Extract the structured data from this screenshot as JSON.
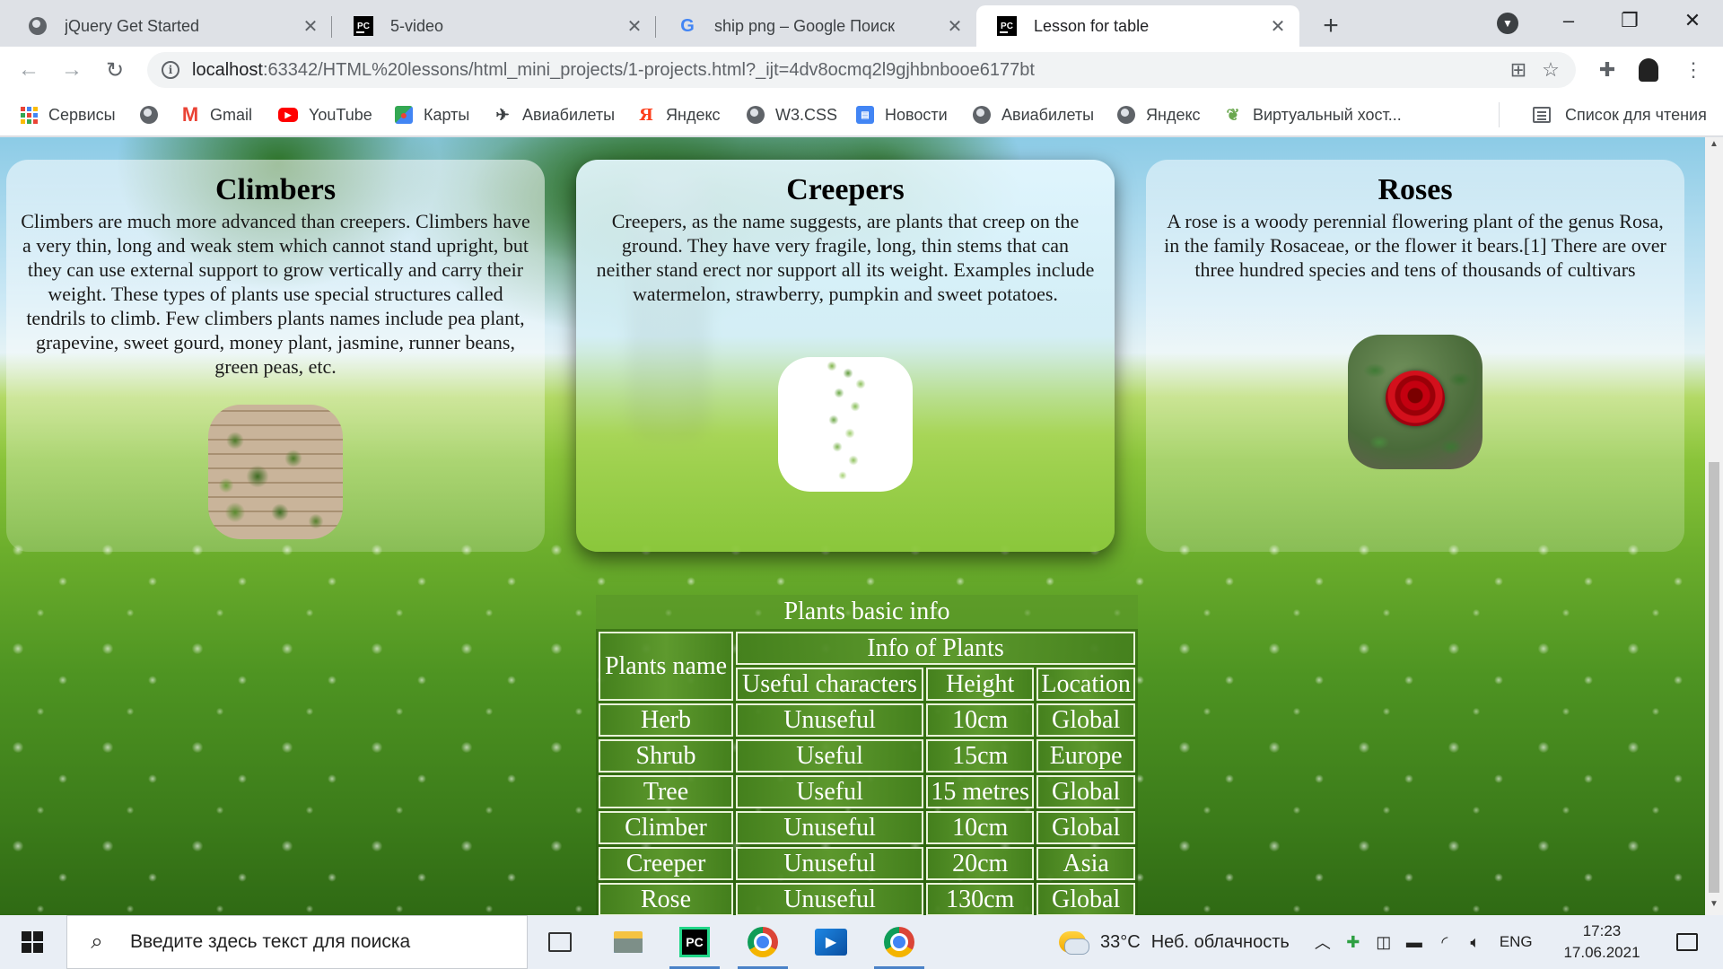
{
  "browser": {
    "tabs": [
      {
        "title": "jQuery Get Started",
        "icon": "globe-icon",
        "active": false
      },
      {
        "title": "5-video",
        "icon": "pycharm-icon",
        "active": false
      },
      {
        "title": "ship png – Google Поиск",
        "icon": "google-icon",
        "active": false
      },
      {
        "title": "Lesson for table",
        "icon": "pycharm-icon",
        "active": true
      }
    ],
    "url_host": "localhost",
    "url_rest": ":63342/HTML%20lessons/html_mini_projects/1-projects.html?_ijt=4dv8ocmq2l9gjhbnbooe6177bt",
    "bookmarks": [
      {
        "label": "Сервисы",
        "icon": "apps-grid-icon"
      },
      {
        "label": "",
        "icon": "globe-icon"
      },
      {
        "label": "Gmail",
        "icon": "gmail-icon"
      },
      {
        "label": "YouTube",
        "icon": "youtube-icon"
      },
      {
        "label": "Карты",
        "icon": "maps-icon"
      },
      {
        "label": "Авиабилеты",
        "icon": "plane-icon"
      },
      {
        "label": "Яндекс",
        "icon": "yandex-icon"
      },
      {
        "label": "W3.CSS",
        "icon": "globe-icon"
      },
      {
        "label": "Новости",
        "icon": "news-icon"
      },
      {
        "label": "Авиабилеты",
        "icon": "globe-icon"
      },
      {
        "label": "Яндекс",
        "icon": "globe-icon"
      },
      {
        "label": "Виртуальный хост...",
        "icon": "leaf-icon"
      }
    ],
    "reading_list": "Список для чтения"
  },
  "page": {
    "cards": [
      {
        "title": "Climbers",
        "text": "Climbers are much more advanced than creepers. Climbers have a very thin, long and weak stem which cannot stand upright, but they can use external support to grow vertically and carry their weight. These types of plants use special structures called tendrils to climb. Few climbers plants names include pea plant, grapevine, sweet gourd, money plant, jasmine, runner beans, green peas, etc."
      },
      {
        "title": "Creepers",
        "text": "Creepers, as the name suggests, are plants that creep on the ground. They have very fragile, long, thin stems that can neither stand erect nor support all its weight. Examples include watermelon, strawberry, pumpkin and sweet potatoes."
      },
      {
        "title": "Roses",
        "text": "A rose is a woody perennial flowering plant of the genus Rosa, in the family Rosaceae, or the flower it bears.[1] There are over three hundred species and tens of thousands of cultivars"
      }
    ],
    "table": {
      "caption": "Plants basic info",
      "head_name": "Plants name",
      "head_group": "Info of Plants",
      "head_cols": [
        "Useful characters",
        "Height",
        "Location"
      ],
      "rows": [
        [
          "Herb",
          "Unuseful",
          "10cm",
          "Global"
        ],
        [
          "Shrub",
          "Useful",
          "15cm",
          "Europe"
        ],
        [
          "Tree",
          "Useful",
          "15 metres",
          "Global"
        ],
        [
          "Climber",
          "Unuseful",
          "10cm",
          "Global"
        ],
        [
          "Creeper",
          "Unuseful",
          "20cm",
          "Asia"
        ],
        [
          "Rose",
          "Unuseful",
          "130cm",
          "Global"
        ]
      ]
    }
  },
  "taskbar": {
    "search_placeholder": "Введите здесь текст для поиска",
    "weather_temp": "33°C",
    "weather_desc": "Неб. облачность",
    "lang": "ENG",
    "time": "17:23",
    "date": "17.06.2021"
  }
}
